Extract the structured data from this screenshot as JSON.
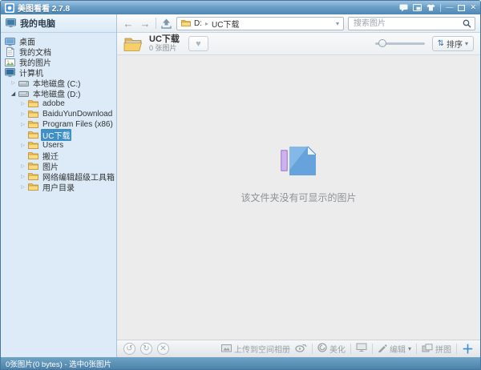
{
  "titlebar": {
    "title": "美图看看 2.7.8",
    "minimize_glyph": "—",
    "close_glyph": "✕"
  },
  "sidebar": {
    "header": "我的电脑",
    "tree": [
      {
        "id": "desktop",
        "label": "桌面",
        "icon": "desktop-icon",
        "indent": 0,
        "expander": "none",
        "selected": false
      },
      {
        "id": "my-documents",
        "label": "我的文档",
        "icon": "documents-icon",
        "indent": 0,
        "expander": "none",
        "selected": false
      },
      {
        "id": "my-pictures",
        "label": "我的图片",
        "icon": "pictures-icon",
        "indent": 0,
        "expander": "none",
        "selected": false
      },
      {
        "id": "computer",
        "label": "计算机",
        "icon": "computer-icon",
        "indent": 0,
        "expander": "none",
        "selected": false
      },
      {
        "id": "disk-c",
        "label": "本地磁盘 (C:)",
        "icon": "drive-icon",
        "indent": 1,
        "expander": "collapsed",
        "selected": false
      },
      {
        "id": "disk-d",
        "label": "本地磁盘 (D:)",
        "icon": "drive-icon",
        "indent": 1,
        "expander": "expanded",
        "selected": false
      },
      {
        "id": "adobe",
        "label": "adobe",
        "icon": "folder-icon",
        "indent": 2,
        "expander": "collapsed",
        "selected": false
      },
      {
        "id": "baiduyun",
        "label": "BaiduYunDownload",
        "icon": "folder-icon",
        "indent": 2,
        "expander": "collapsed",
        "selected": false
      },
      {
        "id": "program-files",
        "label": "Program Files (x86)",
        "icon": "folder-icon",
        "indent": 2,
        "expander": "collapsed",
        "selected": false
      },
      {
        "id": "uc-download",
        "label": "UC下载",
        "icon": "folder-icon",
        "indent": 2,
        "expander": "none",
        "selected": true
      },
      {
        "id": "users",
        "label": "Users",
        "icon": "folder-icon",
        "indent": 2,
        "expander": "collapsed",
        "selected": false
      },
      {
        "id": "banqian",
        "label": "搬迁",
        "icon": "folder-icon",
        "indent": 2,
        "expander": "none",
        "selected": false
      },
      {
        "id": "tupian",
        "label": "图片",
        "icon": "folder-icon",
        "indent": 2,
        "expander": "collapsed",
        "selected": false
      },
      {
        "id": "web-toolbox",
        "label": "网络编辑超级工具箱",
        "icon": "folder-icon",
        "indent": 2,
        "expander": "collapsed",
        "selected": false
      },
      {
        "id": "user-dir",
        "label": "用户目录",
        "icon": "folder-icon",
        "indent": 2,
        "expander": "collapsed",
        "selected": false
      }
    ],
    "expander_collapsed_glyph": "▷",
    "expander_expanded_glyph": "◢"
  },
  "toolbar": {
    "back_glyph": "←",
    "forward_glyph": "→",
    "address_drive": "D:",
    "address_separator": "▸",
    "address_folder": "UC下载",
    "address_caret": "▾",
    "search_placeholder": "搜索图片"
  },
  "content_header": {
    "folder_name": "UC下载",
    "count": "0 张图片",
    "heart_glyph": "♥",
    "sort_glyph": "⇅",
    "sort_label": "排序",
    "sort_caret": "▾"
  },
  "main": {
    "empty_message": "该文件夹没有可显示的图片"
  },
  "bottom_toolbar": {
    "rotate_left_glyph": "↺",
    "rotate_right_glyph": "↻",
    "delete_glyph": "✕",
    "upload_label": "上传到空间相册",
    "beautify_label": "美化",
    "edit_label": "编辑",
    "edit_caret": "▾",
    "collage_label": "拼图",
    "add_glyph": "＋"
  },
  "statusbar": {
    "text": "0张图片(0 bytes) - 选中0张图片"
  },
  "icon_names": [
    "app-logo-icon",
    "chat-icon",
    "mini-mode-icon",
    "skin-icon",
    "minimize-icon",
    "maximize-icon",
    "close-icon",
    "computer-header-icon",
    "desktop-icon",
    "documents-icon",
    "pictures-icon",
    "computer-icon",
    "drive-icon",
    "folder-icon",
    "back-icon",
    "forward-icon",
    "up-level-icon",
    "address-folder-icon",
    "search-icon",
    "open-folder-icon",
    "heart-icon",
    "sort-icon",
    "empty-folder-icon",
    "rotate-left-icon",
    "rotate-right-icon",
    "delete-icon",
    "upload-icon",
    "weibo-icon",
    "beautify-icon",
    "wallpaper-icon",
    "pencil-icon",
    "collage-icon",
    "plus-icon"
  ],
  "colors": {
    "titlebar_blue": "#5f93bb",
    "sidebar_blue": "#dcebf7",
    "selection_blue": "#3f90c8",
    "statusbar_blue": "#4d83aa",
    "accent_blue": "#3e8fd0",
    "folder_yellow": "#f2c04e",
    "content_gray": "#ececec"
  }
}
